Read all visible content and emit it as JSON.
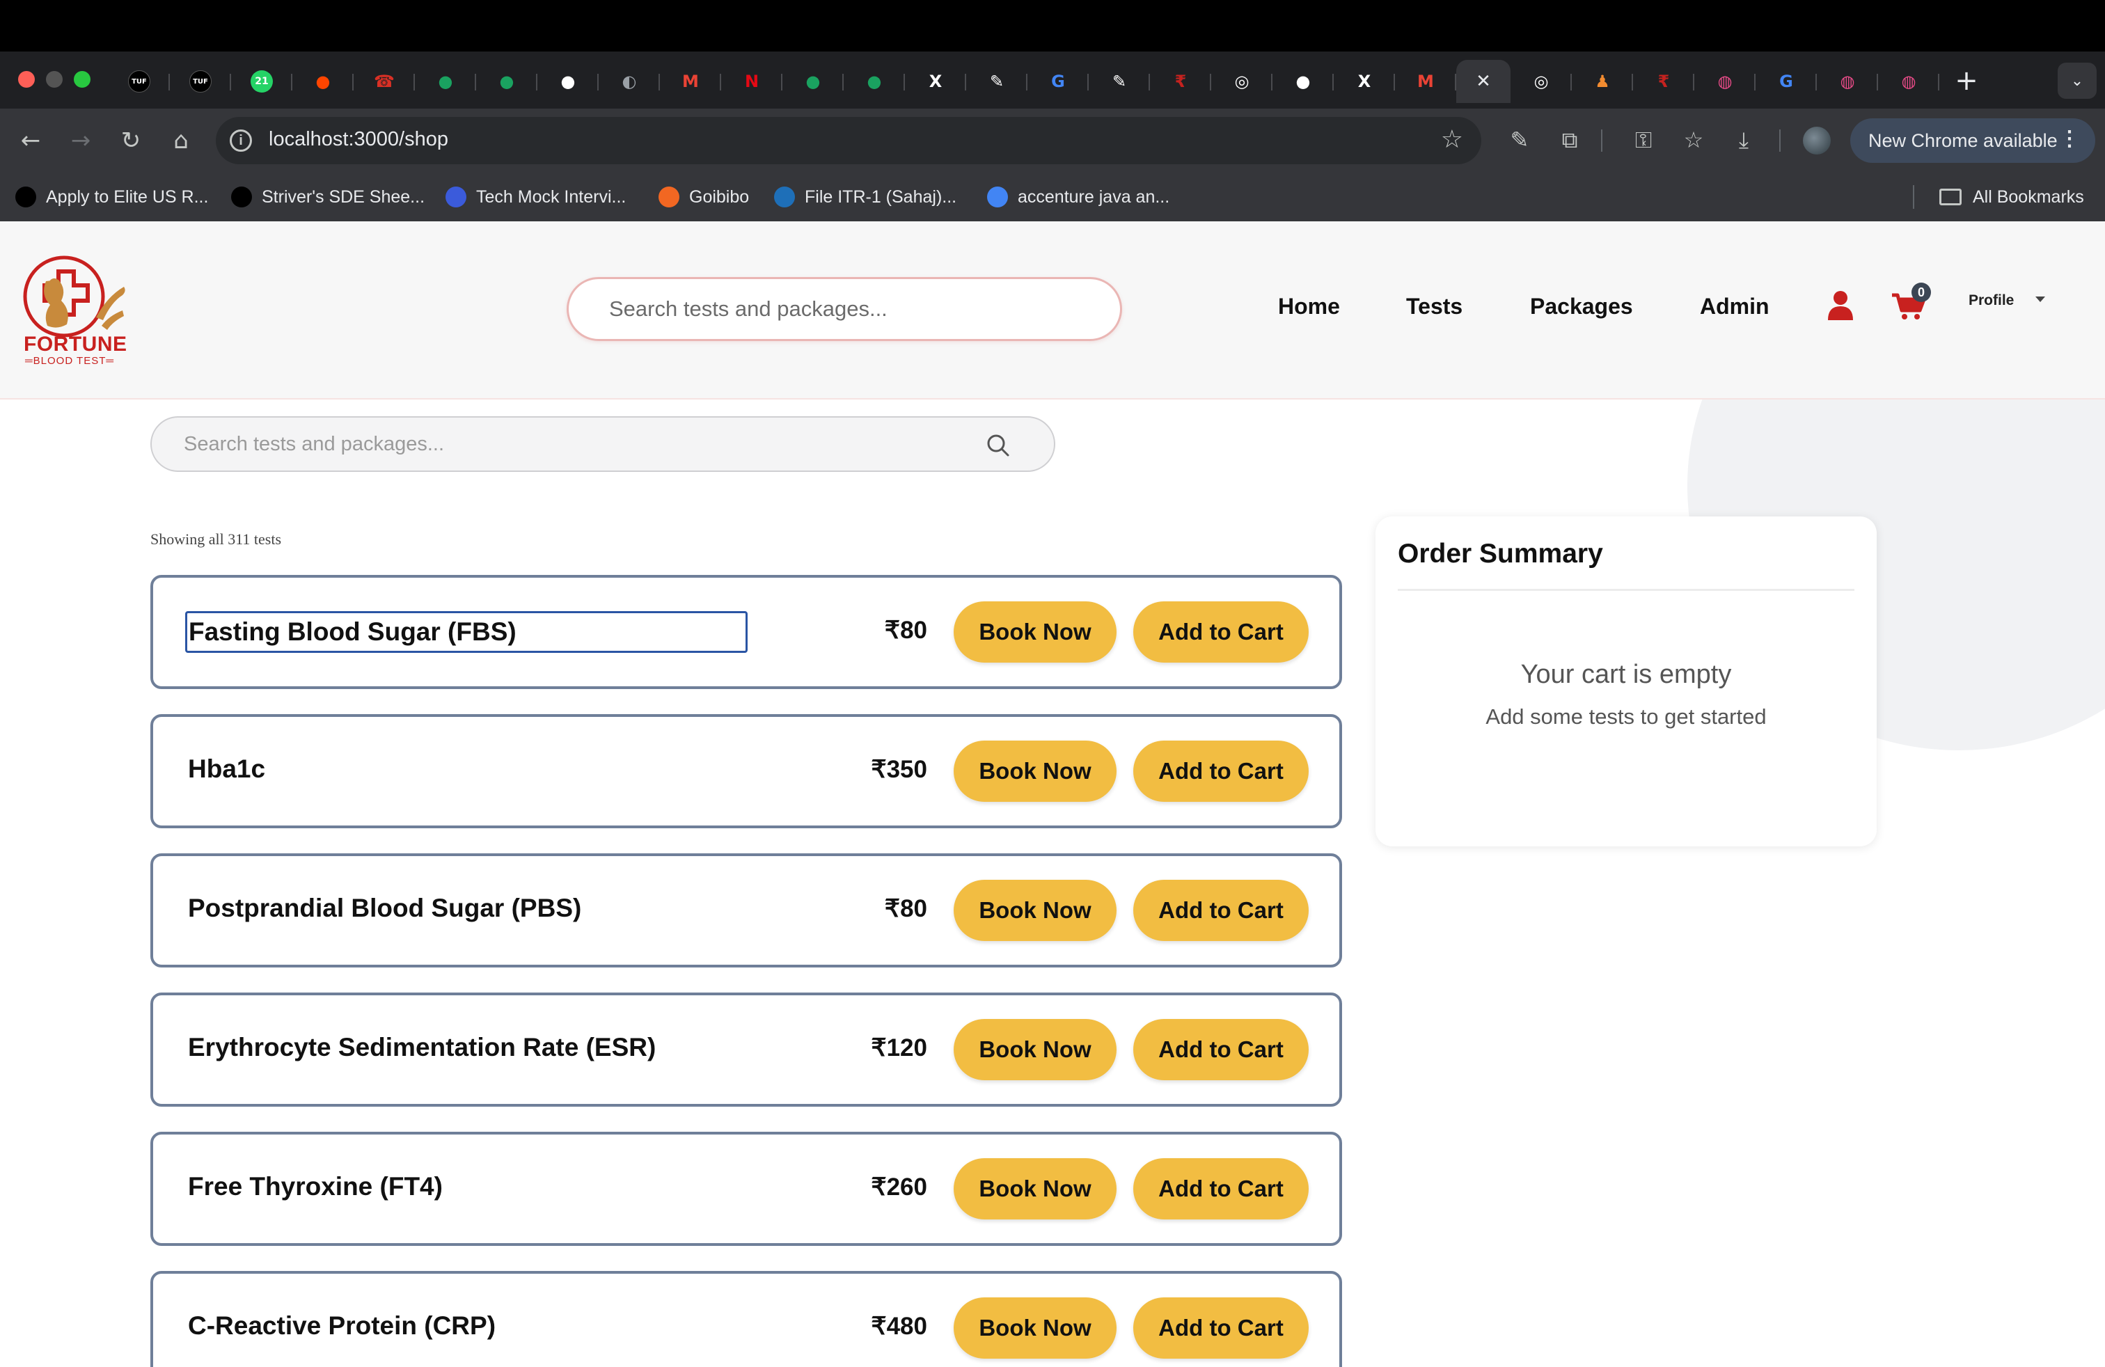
{
  "browser": {
    "tabs": [
      {
        "icon": "tuf-icon",
        "color": "#000000",
        "glyph": "TUF"
      },
      {
        "icon": "tuf-icon",
        "color": "#000000",
        "glyph": "TUF"
      },
      {
        "icon": "whatsapp-icon",
        "color": "#25d366",
        "glyph": "21"
      },
      {
        "icon": "reddit-icon",
        "color": "#ff4500",
        "glyph": "●"
      },
      {
        "icon": "phone-icon",
        "color": "#d93025",
        "glyph": "☎"
      },
      {
        "icon": "chat-bubble-icon",
        "color": "#1aa260",
        "glyph": "●"
      },
      {
        "icon": "chat-bubble-icon",
        "color": "#1aa260",
        "glyph": "●"
      },
      {
        "icon": "github-icon",
        "color": "#ffffff",
        "glyph": "●"
      },
      {
        "icon": "globe-icon",
        "color": "#9aa0a6",
        "glyph": "◐"
      },
      {
        "icon": "gmail-icon",
        "color": "#ea4335",
        "glyph": "M"
      },
      {
        "icon": "netflix-icon",
        "color": "#e50914",
        "glyph": "N"
      },
      {
        "icon": "chat-bubble-icon",
        "color": "#1aa260",
        "glyph": "●"
      },
      {
        "icon": "chat-bubble-icon",
        "color": "#1aa260",
        "glyph": "●"
      },
      {
        "icon": "x-icon",
        "color": "#ffffff",
        "glyph": "X"
      },
      {
        "icon": "pencil-icon",
        "color": "#ffffff",
        "glyph": "✎"
      },
      {
        "icon": "google-icon",
        "color": "#4285f4",
        "glyph": "G"
      },
      {
        "icon": "pencil-icon",
        "color": "#ffffff",
        "glyph": "✎"
      },
      {
        "icon": "rupee-icon",
        "color": "#c5221f",
        "glyph": "₹"
      },
      {
        "icon": "chrome-icon",
        "color": "#ffffff",
        "glyph": "◎"
      },
      {
        "icon": "github-icon",
        "color": "#ffffff",
        "glyph": "●"
      },
      {
        "icon": "x-icon",
        "color": "#ffffff",
        "glyph": "X"
      },
      {
        "icon": "gmail-icon",
        "color": "#ea4335",
        "glyph": "M"
      },
      {
        "icon": "close-icon",
        "color": "#e8eaed",
        "glyph": "✕",
        "active": true
      },
      {
        "icon": "chrome-icon",
        "color": "#ffffff",
        "glyph": "◎"
      },
      {
        "icon": "chess-icon",
        "color": "#f28b30",
        "glyph": "♟"
      },
      {
        "icon": "rupee-icon",
        "color": "#c5221f",
        "glyph": "₹"
      },
      {
        "icon": "dribbble-icon",
        "color": "#ea4c89",
        "glyph": "◍"
      },
      {
        "icon": "google-icon",
        "color": "#4285f4",
        "glyph": "G"
      },
      {
        "icon": "dribbble-icon",
        "color": "#ea4c89",
        "glyph": "◍"
      },
      {
        "icon": "dribbble-icon",
        "color": "#ea4c89",
        "glyph": "◍"
      }
    ],
    "new_tab_glyph": "+",
    "url": "localhost:3000/shop",
    "update_button": "New Chrome available",
    "bookmarks": [
      {
        "label": "Apply to Elite US R...",
        "icon": "elite-icon",
        "color": "#000000"
      },
      {
        "label": "Striver's SDE Shee...",
        "icon": "tuf-icon",
        "color": "#000000"
      },
      {
        "label": "Tech Mock Intervi...",
        "icon": "tech-mock-icon",
        "color": "#3b5bdb"
      },
      {
        "label": "Goibibo",
        "icon": "goibibo-icon",
        "color": "#f26722"
      },
      {
        "label": "File ITR-1 (Sahaj)...",
        "icon": "itr-icon",
        "color": "#1e6fb8"
      },
      {
        "label": "accenture java an...",
        "icon": "google-icon",
        "color": "#4285f4"
      }
    ],
    "all_bookmarks": "All Bookmarks"
  },
  "header": {
    "logo_text": "FORTUNE",
    "logo_sub": "BLOOD TEST",
    "search_placeholder": "Search tests and packages...",
    "nav": [
      "Home",
      "Tests",
      "Packages",
      "Admin"
    ],
    "cart_count": "0",
    "profile": "Profile",
    "accent": "#c8211f"
  },
  "shop": {
    "search_placeholder": "Search tests and packages...",
    "showing": "Showing all 311 tests",
    "tests": [
      {
        "name": "Fasting Blood Sugar (FBS)",
        "price": "₹80"
      },
      {
        "name": "Hba1c",
        "price": "₹350"
      },
      {
        "name": "Postprandial Blood Sugar (PBS)",
        "price": "₹80"
      },
      {
        "name": "Erythrocyte Sedimentation Rate (ESR)",
        "price": "₹120"
      },
      {
        "name": "Free Thyroxine (FT4)",
        "price": "₹260"
      },
      {
        "name": "C-Reactive Protein (CRP)",
        "price": "₹480"
      }
    ],
    "book_label": "Book Now",
    "cart_label": "Add to Cart",
    "button_color": "#f2bd42"
  },
  "summary": {
    "title": "Order Summary",
    "empty": "Your cart is empty",
    "hint": "Add some tests to get started"
  }
}
